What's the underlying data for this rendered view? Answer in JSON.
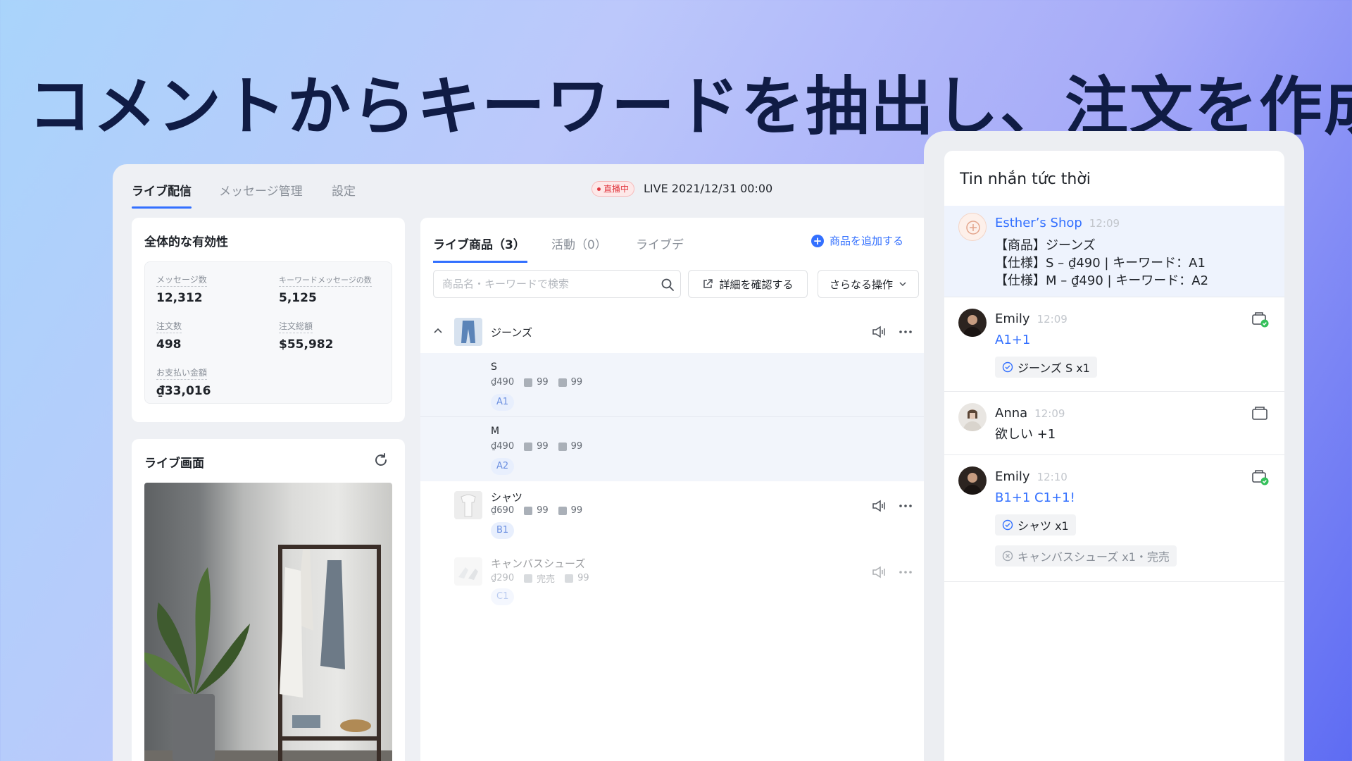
{
  "headline": "コメントからキーワードを抽出し、注文を作成",
  "main": {
    "tabs": [
      {
        "label": "ライブ配信",
        "active": true
      },
      {
        "label": "メッセージ管理",
        "active": false
      },
      {
        "label": "設定",
        "active": false
      }
    ],
    "live_badge": "直播中",
    "live_time": "LIVE 2021/12/31 00:00"
  },
  "stats": {
    "title": "全体的な有効性",
    "items": [
      {
        "label": "メッセージ数",
        "value": "12,312"
      },
      {
        "label": "キーワードメッセージの数",
        "value": "5,125"
      },
      {
        "label": "注文数",
        "value": "498"
      },
      {
        "label": "注文総額",
        "value": "$55,982"
      },
      {
        "label": "お支払い金額",
        "value": "₫33,016"
      }
    ]
  },
  "live_screen": {
    "title": "ライブ画面",
    "refresh_icon": "refresh-icon"
  },
  "products": {
    "tabs": [
      "ライブ商品（3）",
      "活動（0）",
      "ライブデ"
    ],
    "add_label": "商品を追加する",
    "search_placeholder": "商品名・キーワードで検索",
    "details_label": "詳細を確認する",
    "more_label": "さらなる操作",
    "items": [
      {
        "name": "ジーンズ",
        "variants": [
          {
            "name": "S",
            "price": "₫490",
            "stock": "99",
            "sold": "99",
            "keyword": "A1"
          },
          {
            "name": "M",
            "price": "₫490",
            "stock": "99",
            "sold": "99",
            "keyword": "A2"
          }
        ]
      },
      {
        "name": "シャツ",
        "price": "₫690",
        "stock": "99",
        "sold": "99",
        "keyword": "B1"
      },
      {
        "name": "キャンバスシューズ",
        "price": "₫290",
        "stock": "完売",
        "sold": "99",
        "keyword": "C1"
      }
    ]
  },
  "chat": {
    "title": "Tin nhắn tức thời",
    "messages": [
      {
        "sender": "Esther’s Shop",
        "time": "12:09",
        "lines": [
          "【商品】ジーンズ",
          "【仕様】S – ₫490 | キーワード：A1",
          "【仕様】M – ₫490 | キーワード：A2"
        ]
      },
      {
        "sender": "Emily",
        "time": "12:09",
        "text": "A1+1",
        "orders": [
          "ジーンズ S x1"
        ]
      },
      {
        "sender": "Anna",
        "time": "12:09",
        "text": "欲しい +1"
      },
      {
        "sender": "Emily",
        "time": "12:10",
        "text": "B1+1 C1+1!",
        "orders": [
          "シャツ x1",
          "キャンバスシューズ x1・完売"
        ]
      }
    ]
  },
  "colors": {
    "accent": "#3370ff",
    "live_red": "#e0373f",
    "headline": "#101c45",
    "success": "#34c05a"
  }
}
